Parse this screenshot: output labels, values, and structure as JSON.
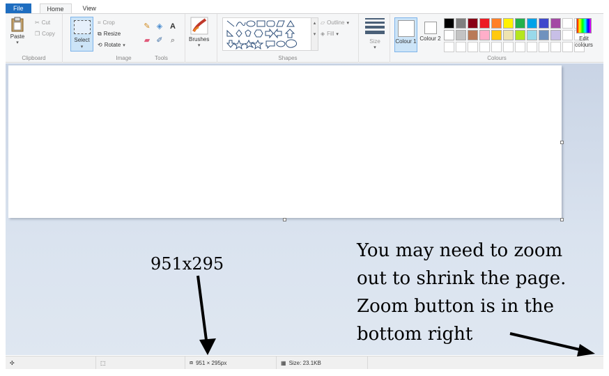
{
  "tabs": [
    {
      "label": "File"
    },
    {
      "label": "Home"
    },
    {
      "label": "View"
    }
  ],
  "ribbon": {
    "clipboard": {
      "group_label": "Clipboard",
      "paste_label": "Paste",
      "cut_label": "Cut",
      "copy_label": "Copy"
    },
    "image": {
      "group_label": "Image",
      "select_label": "Select",
      "crop_label": "Crop",
      "resize_label": "Resize",
      "rotate_label": "Rotate"
    },
    "tools": {
      "group_label": "Tools"
    },
    "brushes": {
      "label": "Brushes"
    },
    "shapes": {
      "group_label": "Shapes",
      "outline_label": "Outline",
      "fill_label": "Fill"
    },
    "size": {
      "label": "Size"
    },
    "colours": {
      "group_label": "Colours",
      "colour1_label": "Colour 1",
      "colour2_label": "Colour 2",
      "edit_label": "Edit colours",
      "palette": [
        "#000000",
        "#7f7f7f",
        "#880015",
        "#ed1c24",
        "#ff7f27",
        "#fff200",
        "#22b14c",
        "#00a2e8",
        "#3f48cc",
        "#a349a4",
        "",
        "",
        "#ffffff",
        "#c3c3c3",
        "#b97a57",
        "#ffaec9",
        "#ffc90e",
        "#efe4b0",
        "#b5e61d",
        "#99d9ea",
        "#7092be",
        "#c8bfe7",
        "",
        "",
        "",
        "",
        "",
        "",
        "",
        "",
        "",
        "",
        "",
        "",
        "",
        ""
      ]
    }
  },
  "statusbar": {
    "dimensions": "951 × 295px",
    "file_size": "Size: 23.1KB"
  },
  "annotations": {
    "size_note": "951x295",
    "zoom_note_lines": [
      "You may need to zoom",
      "out to shrink the page.",
      "Zoom button is in the",
      "bottom right"
    ]
  }
}
